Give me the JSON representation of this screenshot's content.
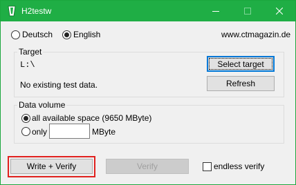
{
  "window": {
    "title": "H2testw",
    "accent": "#1fae45"
  },
  "language": {
    "options": [
      "Deutsch",
      "English"
    ],
    "selected": "English"
  },
  "website": "www.ctmagazin.de",
  "target": {
    "group_title": "Target",
    "path": "L:\\",
    "status": "No existing test data.",
    "select_button": "Select target",
    "refresh_button": "Refresh"
  },
  "data_volume": {
    "group_title": "Data volume",
    "all_space_label": "all available space (9650 MByte)",
    "only_label": "only",
    "only_value": "",
    "unit": "MByte",
    "selected": "all available space"
  },
  "actions": {
    "write_verify": "Write + Verify",
    "verify": "Verify",
    "endless_verify": "endless verify",
    "endless_verify_checked": false
  },
  "highlight_color": "#e0201d"
}
